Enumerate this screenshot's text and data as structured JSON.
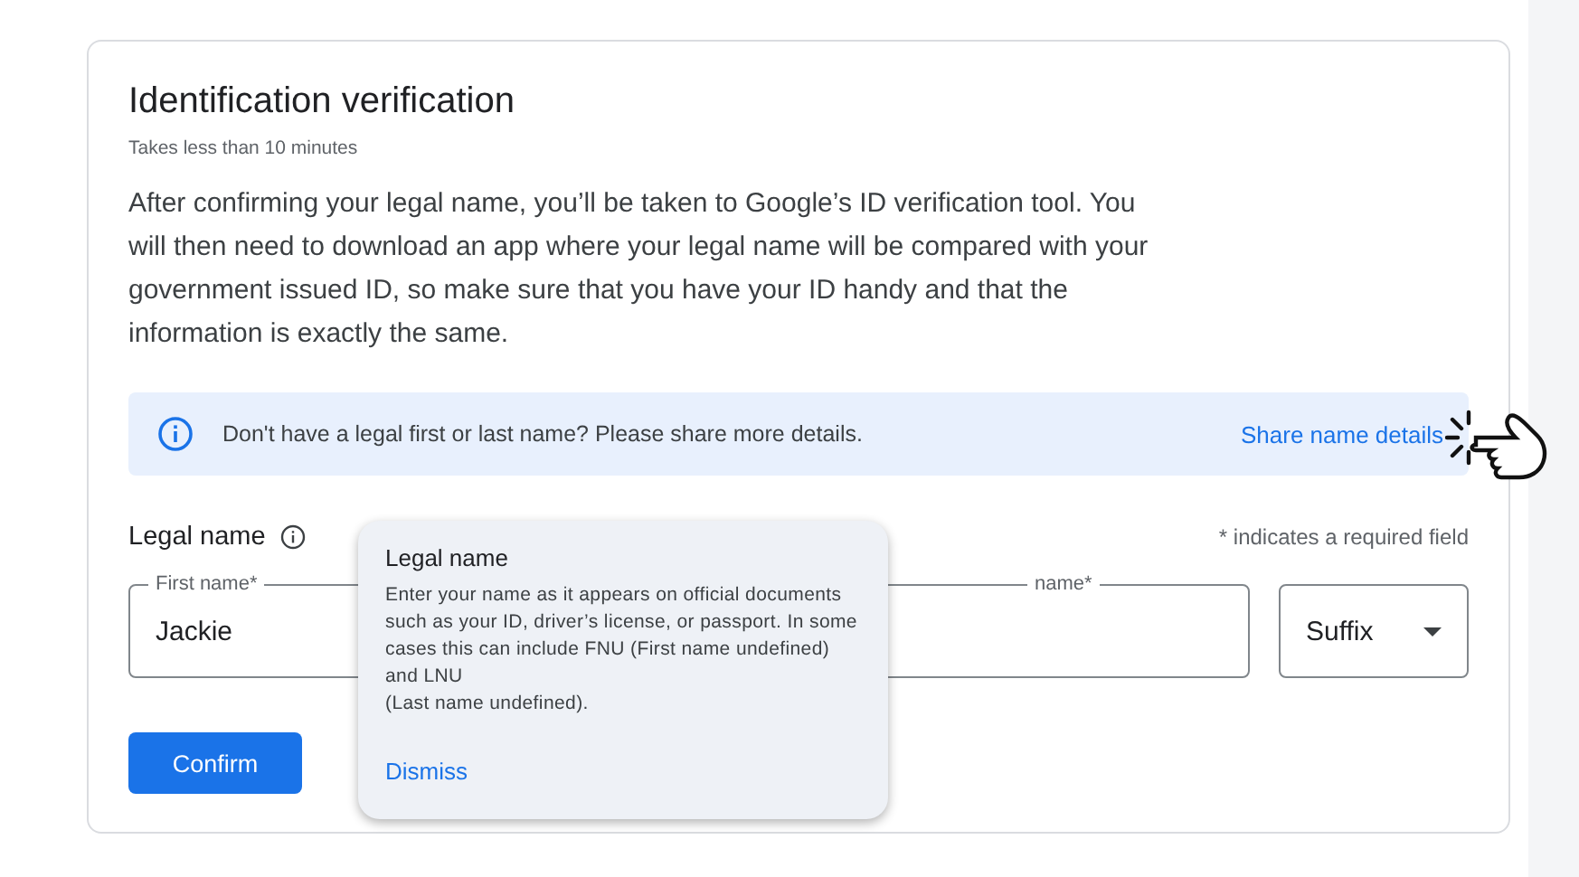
{
  "title": "Identification verification",
  "subtitle": "Takes less than 10 minutes",
  "description": "After confirming your legal name, you’ll be taken to Google’s ID verification tool. You will then need to download an app where your legal name will be compared with your government issued ID, so make sure that you have your ID handy and that the information is exactly the same.",
  "banner": {
    "message": "Don't have a legal first or last name? Please share more details.",
    "link": "Share name details"
  },
  "legal_name": {
    "label": "Legal name",
    "required_note": "* indicates a required field"
  },
  "fields": [
    {
      "kind": "text",
      "label": "First name*",
      "value": "Jackie"
    },
    {
      "kind": "text",
      "label": "name*"
    },
    {
      "kind": "select",
      "value": "Suffix"
    }
  ],
  "confirm_button": "Confirm",
  "tooltip": {
    "title": "Legal name",
    "body": "Enter your name as it appears on official documents such as your ID, driver’s license, or passport. In some cases this can include FNU (First name undefined) and LNU\n(Last name undefined).",
    "action": "Dismiss"
  }
}
